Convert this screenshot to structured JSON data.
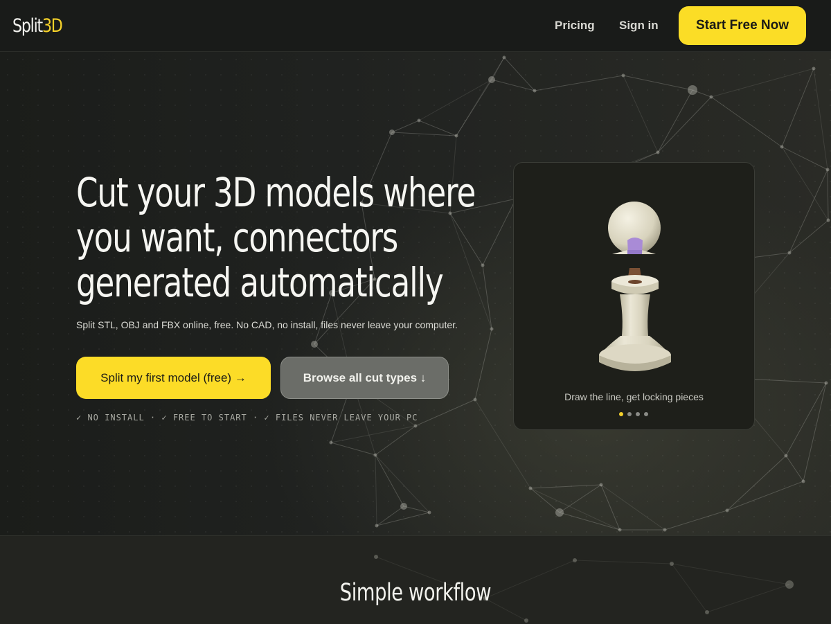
{
  "brand": {
    "name_main": "Split",
    "name_accent": "3D",
    "accent_color": "#f6d22a"
  },
  "nav": {
    "pricing_label": "Pricing",
    "signin_label": "Sign in",
    "cta_label": "Start Free Now"
  },
  "hero": {
    "title_lines": [
      "Cut your 3D models where",
      "you want, connectors",
      "generated automatically"
    ],
    "subtitle": "Split STL, OBJ and FBX online, free. No CAD, no install, files never leave your computer.",
    "primary_button_label": "Split my first model (free) →",
    "secondary_button_label": "Browse all cut types ↓",
    "trust_line": "✓ NO INSTALL · ✓ FREE TO START · ✓ FILES NEVER LEAVE YOUR PC"
  },
  "preview_card": {
    "image_subject": "chess-pawn-split",
    "caption": "Draw the line, get locking pieces",
    "slides_total": 4,
    "active_slide": 1
  },
  "workflow": {
    "title": "Simple workflow"
  },
  "colors": {
    "accent_yellow": "#fcdc27",
    "background": "#1e201c",
    "header_bg": "#191b19",
    "secondary_button": "#6b6d68"
  }
}
